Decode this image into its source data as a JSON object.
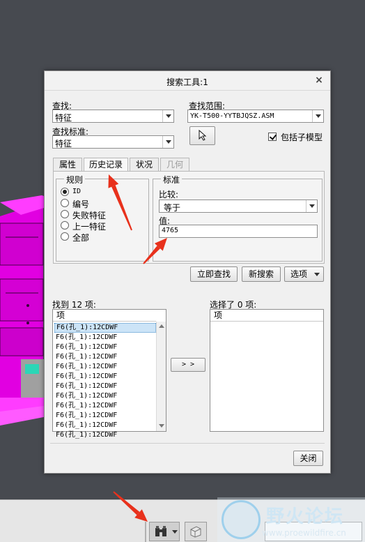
{
  "dialog": {
    "title": "搜索工具:1",
    "close_glyph": "×",
    "find_label": "查找:",
    "find_value": "特征",
    "criteria_label": "查找标准:",
    "criteria_value": "特征",
    "scope_label": "查找范围:",
    "scope_value": "YK-T500-YYTBJQSZ.ASM",
    "include_submodels_label": "包括子模型",
    "include_submodels_checked": true,
    "tabs": [
      {
        "label": "属性",
        "active": false,
        "enabled": true
      },
      {
        "label": "历史记录",
        "active": true,
        "enabled": true
      },
      {
        "label": "状况",
        "active": false,
        "enabled": true
      },
      {
        "label": "几何",
        "active": false,
        "enabled": false
      }
    ],
    "rules": {
      "title": "规则",
      "options": [
        {
          "label": "ID",
          "selected": true
        },
        {
          "label": "编号",
          "selected": false
        },
        {
          "label": "失败特征",
          "selected": false
        },
        {
          "label": "上一特征",
          "selected": false
        },
        {
          "label": "全部",
          "selected": false
        }
      ]
    },
    "criteria_group": {
      "title": "标准",
      "compare_label": "比较:",
      "compare_value": "等于",
      "value_label": "值:",
      "value": "4765"
    },
    "buttons": {
      "find_now": "立即查找",
      "new_search": "新搜索",
      "options": "选项",
      "move": "> >",
      "close": "关闭"
    },
    "found": {
      "label": "找到 12 项:",
      "column": "项",
      "items": [
        "F6(孔_1):12CDWF",
        "F6(孔_1):12CDWF",
        "F6(孔_1):12CDWF",
        "F6(孔_1):12CDWF",
        "F6(孔_1):12CDWF",
        "F6(孔_1):12CDWF",
        "F6(孔_1):12CDWF",
        "F6(孔_1):12CDWF",
        "F6(孔_1):12CDWF",
        "F6(孔_1):12CDWF",
        "F6(孔_1):12CDWF",
        "F6(孔_1):12CDWF"
      ],
      "selected_index": 0
    },
    "selected": {
      "label": "选择了 0 项:",
      "column": "项"
    }
  },
  "watermark": {
    "title": "野火论坛",
    "url": "www.proewildfire.cn"
  },
  "colors": {
    "annotation_arrow": "#e8311c",
    "cad_magenta": "#ff00ff",
    "background": "#474a50"
  }
}
